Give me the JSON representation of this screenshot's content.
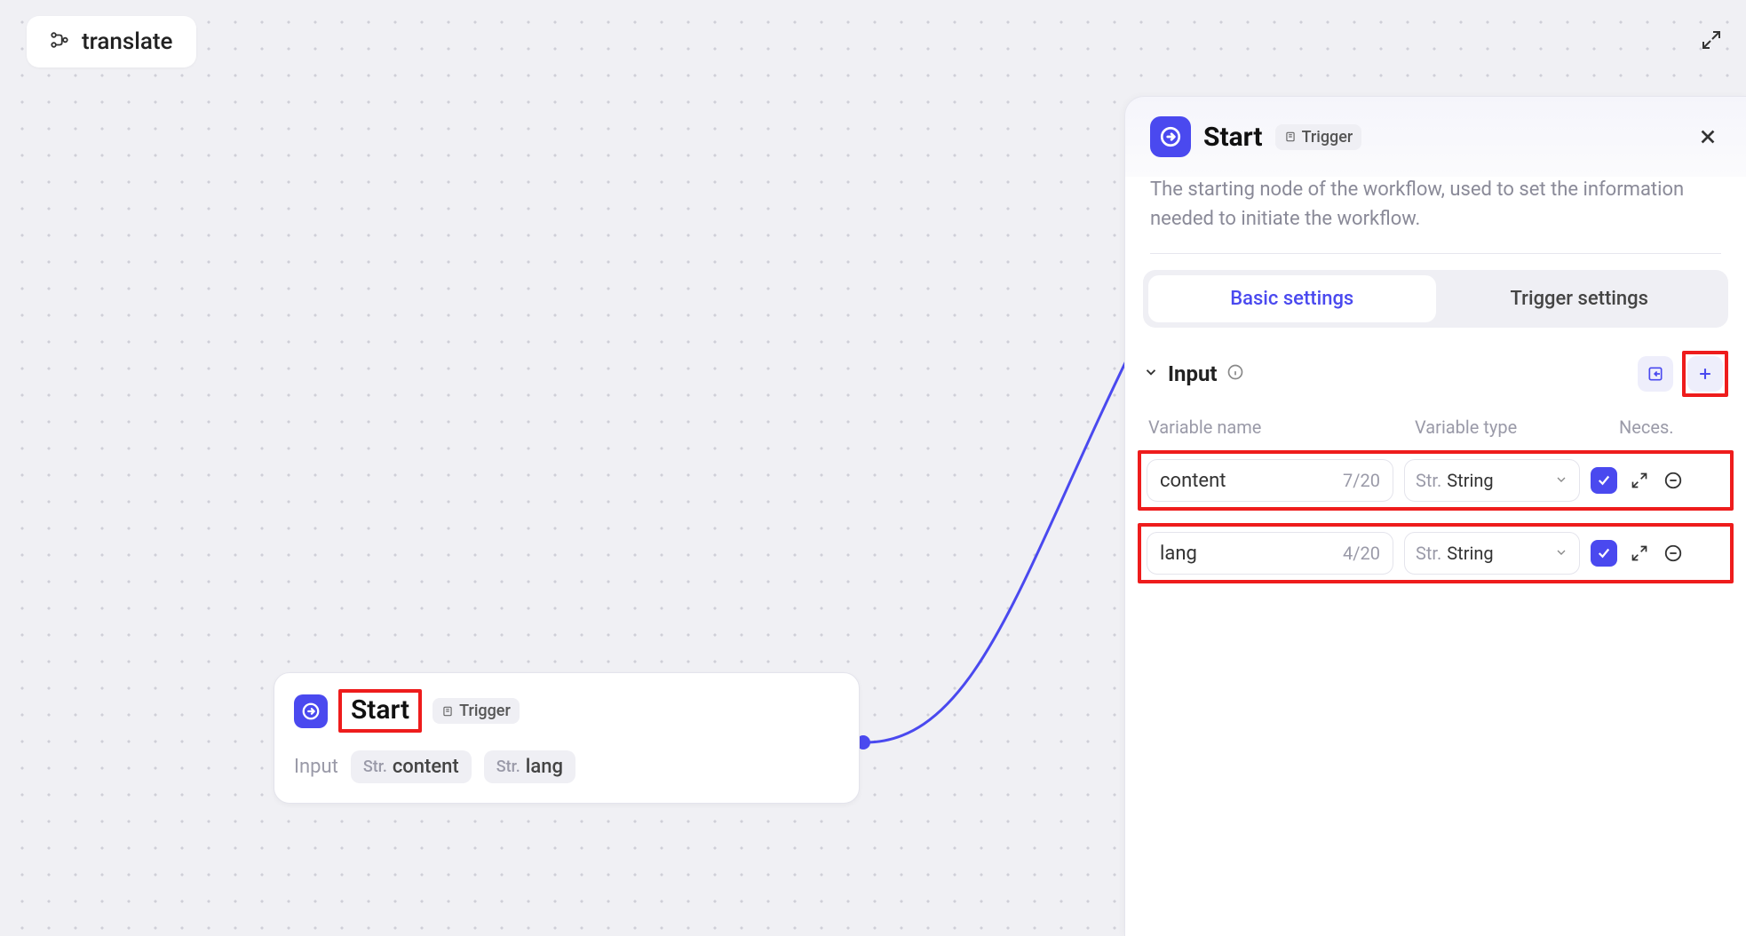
{
  "workflow": {
    "name": "translate"
  },
  "node": {
    "title": "Start",
    "badge": "Trigger",
    "input_label": "Input",
    "vars": [
      {
        "type_prefix": "Str.",
        "name": "content"
      },
      {
        "type_prefix": "Str.",
        "name": "lang"
      }
    ]
  },
  "panel": {
    "title": "Start",
    "badge": "Trigger",
    "description": "The starting node of the workflow, used to set the information needed to initiate the workflow.",
    "tabs": {
      "basic": "Basic settings",
      "trigger": "Trigger settings"
    },
    "section_input": "Input",
    "columns": {
      "name": "Variable name",
      "type": "Variable type",
      "nec": "Neces."
    },
    "rows": [
      {
        "name": "content",
        "count": "7/20",
        "type_prefix": "Str.",
        "type": "String",
        "necessary": true
      },
      {
        "name": "lang",
        "count": "4/20",
        "type_prefix": "Str.",
        "type": "String",
        "necessary": true
      }
    ]
  }
}
